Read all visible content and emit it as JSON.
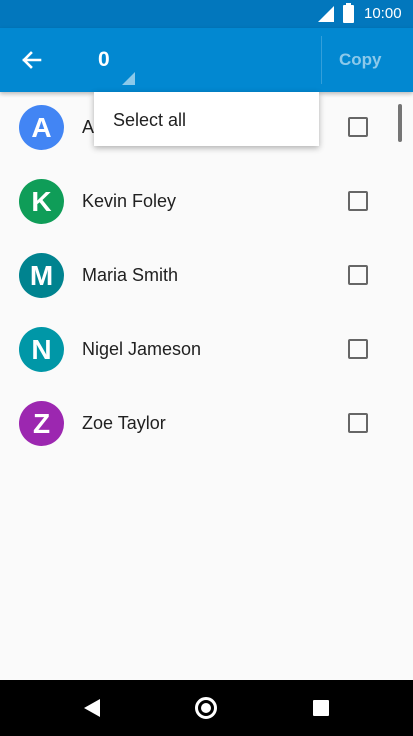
{
  "status_bar": {
    "time": "10:00",
    "icons": [
      "signal-icon",
      "battery-icon"
    ]
  },
  "app_bar": {
    "back_icon": "arrow-left-icon",
    "selected_count": "0",
    "copy_label": "Copy"
  },
  "dropdown": {
    "options": [
      {
        "label": "Select all"
      }
    ]
  },
  "contacts": [
    {
      "initial": "A",
      "name": "A",
      "color": "#4285f4",
      "checked": false
    },
    {
      "initial": "K",
      "name": "Kevin Foley",
      "color": "#0f9d58",
      "checked": false
    },
    {
      "initial": "M",
      "name": "Maria Smith",
      "color": "#00838f",
      "checked": false
    },
    {
      "initial": "N",
      "name": "Nigel Jameson",
      "color": "#0097a7",
      "checked": false
    },
    {
      "initial": "Z",
      "name": "Zoe Taylor",
      "color": "#9c27b0",
      "checked": false
    }
  ],
  "colors": {
    "status_bar": "#0277bd",
    "app_bar": "#0288d1"
  }
}
